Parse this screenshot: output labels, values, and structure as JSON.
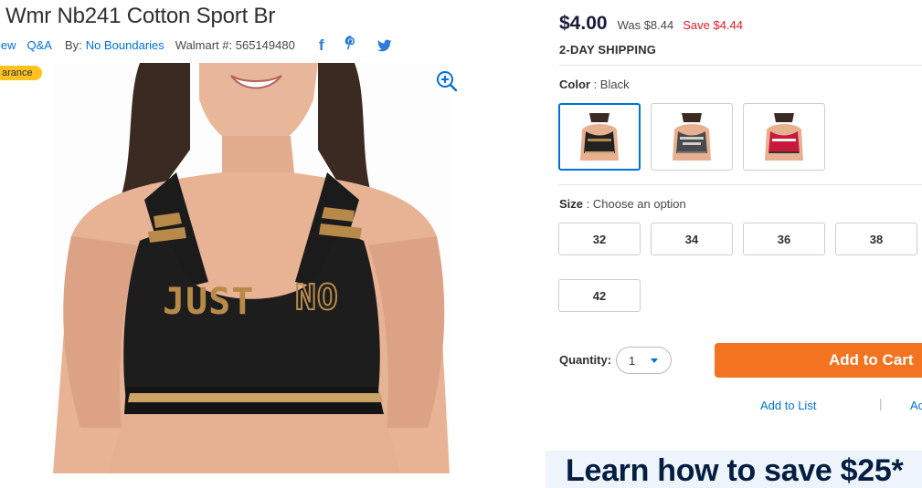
{
  "product": {
    "title": "Wmr Nb241 Cotton Sport Br",
    "review_link": "iew",
    "qa_link": "Q&A",
    "by_label": "By:",
    "brand": "No Boundaries",
    "walmart_number": "Walmart #: 565149480",
    "badge": "arance",
    "image_print_text": "JUST NO"
  },
  "social": {
    "facebook_icon": "facebook-icon",
    "pinterest_icon": "pinterest-icon",
    "twitter_icon": "twitter-icon"
  },
  "pricing": {
    "current": "$4.00",
    "was": "Was $8.44",
    "save": "Save $4.44",
    "shipping": "2-DAY SHIPPING"
  },
  "color": {
    "label": "Color",
    "selected": "Black",
    "options": [
      {
        "top": "#2b2b2b",
        "print": "#b88a4a",
        "text": "JUST NO"
      },
      {
        "top": "#4a4a4a",
        "print": "#cfcfcf",
        "text": "DON'T"
      },
      {
        "top": "#c8193c",
        "print": "#f2f2f2",
        "text": "SOLDIER"
      }
    ]
  },
  "size": {
    "label": "Size",
    "placeholder": "Choose an option",
    "options": [
      "32",
      "34",
      "36",
      "38",
      "42"
    ]
  },
  "quantity": {
    "label": "Quantity:",
    "value": "1"
  },
  "actions": {
    "add_to_cart": "Add to Cart",
    "add_to_list": "Add to List",
    "separator": "|",
    "add_to_registry": "Ac"
  },
  "promo": {
    "text": "Learn how to save $25*"
  },
  "colors": {
    "accent_blue": "#0071dc",
    "cart_orange": "#f47321",
    "save_red": "#de1c24",
    "badge_yellow": "#ffc220"
  }
}
